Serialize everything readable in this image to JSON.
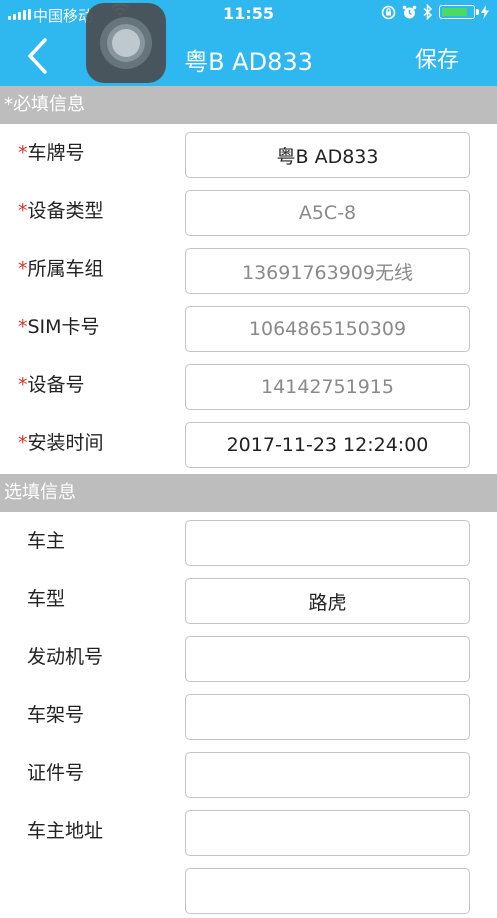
{
  "status_bar": {
    "carrier": "中国移动",
    "time": "11:55",
    "battery_level": 0.85,
    "battery_color": "#4cd964"
  },
  "nav": {
    "title": "粤B AD833",
    "save_label": "保存",
    "bar_color": "#2fb7ef"
  },
  "sections": {
    "required_title": "*必填信息",
    "optional_title": "选填信息"
  },
  "required_fields": [
    {
      "label": "车牌号",
      "value": "粤B AD833",
      "editable": true
    },
    {
      "label": "设备类型",
      "value": "A5C-8",
      "editable": false
    },
    {
      "label": "所属车组",
      "value": "13691763909无线",
      "editable": false
    },
    {
      "label": "SIM卡号",
      "value": "1064865150309",
      "editable": false
    },
    {
      "label": "设备号",
      "value": "14142751915",
      "editable": false
    },
    {
      "label": "安装时间",
      "value": "2017-11-23 12:24:00",
      "editable": true
    }
  ],
  "optional_fields": [
    {
      "label": "车主",
      "value": ""
    },
    {
      "label": "车型",
      "value": "路虎"
    },
    {
      "label": "发动机号",
      "value": ""
    },
    {
      "label": "车架号",
      "value": ""
    },
    {
      "label": "证件号",
      "value": ""
    },
    {
      "label": "车主地址",
      "value": ""
    },
    {
      "label": "",
      "value": ""
    }
  ],
  "required_marker": "*",
  "icons": {
    "back": "chevron-left-icon",
    "assistive_touch": "assistive-touch-icon",
    "signal": "signal-icon",
    "wifi": "wifi-icon",
    "orientation_lock": "orientation-lock-icon",
    "alarm": "alarm-icon",
    "bluetooth": "bluetooth-icon",
    "battery": "battery-icon",
    "charging": "charging-icon"
  }
}
